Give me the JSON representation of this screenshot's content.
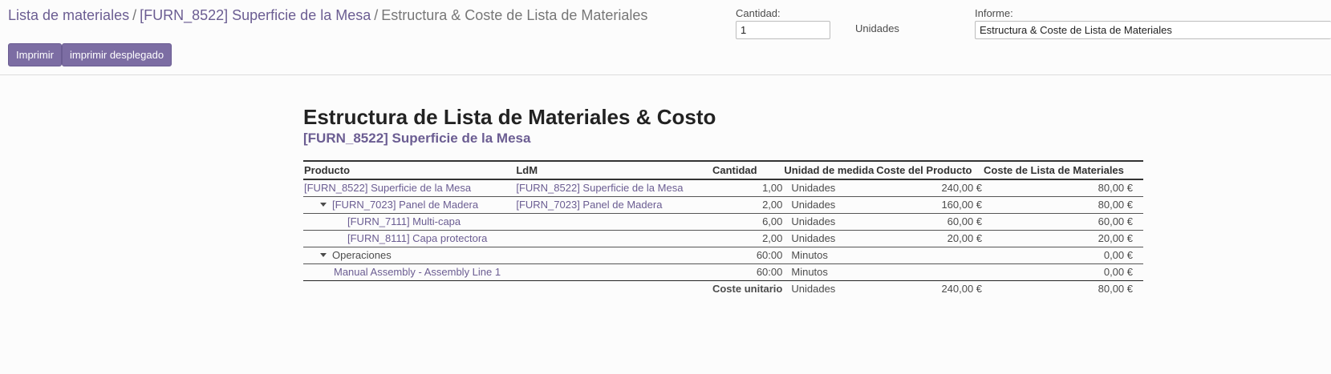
{
  "breadcrumb": {
    "item1": "Lista de materiales",
    "item2": "[FURN_8522] Superficie de la Mesa",
    "item3": "Estructura & Coste de Lista de Materiales",
    "separator": "/"
  },
  "buttons": {
    "print": "Imprimir",
    "print_unfolded": "imprimir desplegado"
  },
  "quantity": {
    "label": "Cantidad:",
    "value": "1",
    "unit": "Unidades"
  },
  "report_select": {
    "label": "Informe:",
    "value": "Estructura & Coste de Lista de Materiales"
  },
  "report": {
    "title": "Estructura de Lista de Materiales & Costo",
    "subtitle": "[FURN_8522] Superficie de la Mesa",
    "columns": {
      "product": "Producto",
      "bom": "LdM",
      "quantity": "Cantidad",
      "uom": "Unidad de medida",
      "product_cost": "Coste del Producto",
      "bom_cost": "Coste de Lista de Materiales"
    },
    "rows": [
      {
        "product": "[FURN_8522] Superficie de la Mesa",
        "bom": "[FURN_8522] Superficie de la Mesa",
        "quantity": "1,00",
        "uom": "Unidades",
        "product_cost": "240,00 €",
        "bom_cost": "80,00 €"
      },
      {
        "product": "[FURN_7023] Panel de Madera",
        "bom": "[FURN_7023] Panel de Madera",
        "quantity": "2,00",
        "uom": "Unidades",
        "product_cost": "160,00 €",
        "bom_cost": "80,00 €"
      },
      {
        "product": "[FURN_7111] Multi-capa",
        "bom": "",
        "quantity": "6,00",
        "uom": "Unidades",
        "product_cost": "60,00 €",
        "bom_cost": "60,00 €"
      },
      {
        "product": "[FURN_8111] Capa protectora",
        "bom": "",
        "quantity": "2,00",
        "uom": "Unidades",
        "product_cost": "20,00 €",
        "bom_cost": "20,00 €"
      },
      {
        "product": "Operaciones",
        "bom": "",
        "quantity": "60:00",
        "uom": "Minutos",
        "product_cost": "",
        "bom_cost": "0,00 €"
      },
      {
        "product": "Manual Assembly - Assembly Line 1",
        "bom": "",
        "quantity": "60:00",
        "uom": "Minutos",
        "product_cost": "",
        "bom_cost": "0,00 €"
      }
    ],
    "total": {
      "label": "Coste unitario",
      "uom": "Unidades",
      "product_cost": "240,00 €",
      "bom_cost": "80,00 €"
    }
  },
  "colors": {
    "accent": "#7c6da3",
    "link": "#6b5d92"
  }
}
